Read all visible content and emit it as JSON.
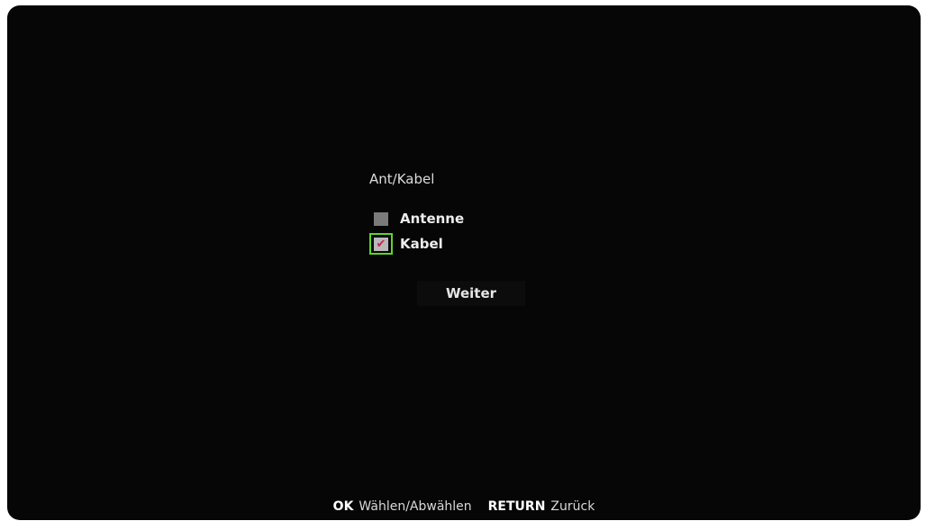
{
  "setup": {
    "heading": "Ant/Kabel",
    "options": [
      {
        "label": "Antenne",
        "checked": false,
        "focused": false
      },
      {
        "label": "Kabel",
        "checked": true,
        "focused": true
      }
    ],
    "next_label": "Weiter"
  },
  "footer": {
    "ok_key": "OK",
    "ok_action": "Wählen/Abwählen",
    "return_key": "RETURN",
    "return_action": "Zurück"
  },
  "colors": {
    "focus": "#5cd52a",
    "check": "#c9234f",
    "background": "#060606"
  }
}
